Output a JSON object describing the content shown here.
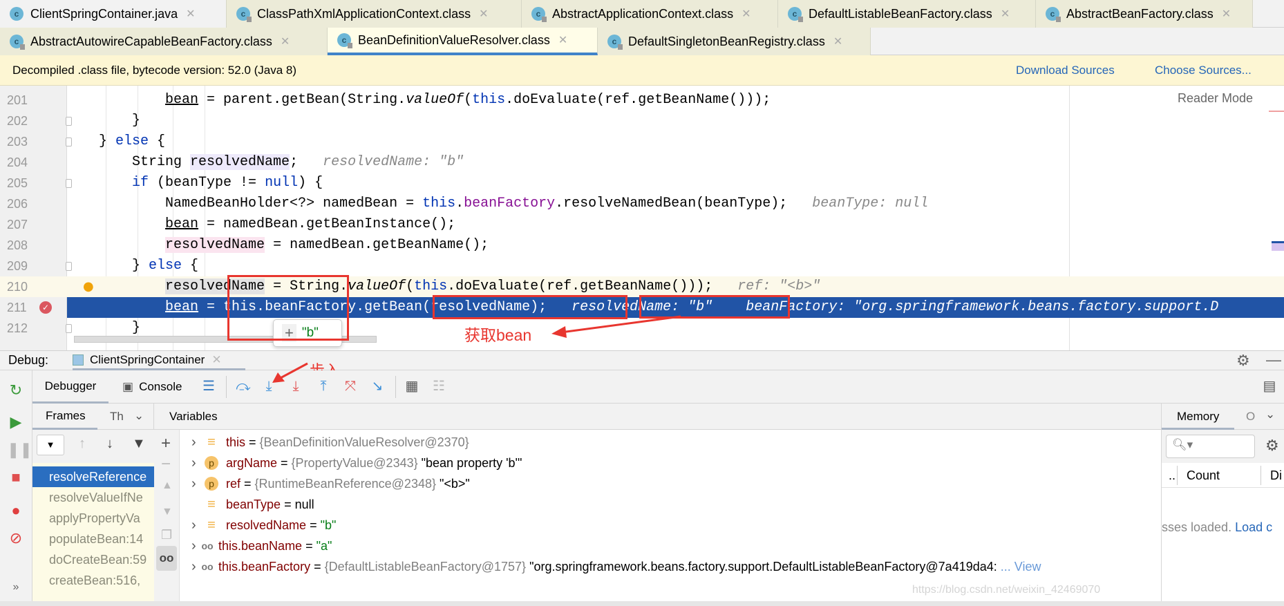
{
  "tabs_row1": [
    {
      "label": "ClientSpringContainer.java",
      "active": false
    },
    {
      "label": "ClassPathXmlApplicationContext.class",
      "active": false
    },
    {
      "label": "AbstractApplicationContext.class",
      "active": false
    },
    {
      "label": "DefaultListableBeanFactory.class",
      "active": false
    },
    {
      "label": "AbstractBeanFactory.class",
      "active": false
    }
  ],
  "tabs_row2": [
    {
      "label": "AbstractAutowireCapableBeanFactory.class",
      "active": false
    },
    {
      "label": "BeanDefinitionValueResolver.class",
      "active": true
    },
    {
      "label": "DefaultSingletonBeanRegistry.class",
      "active": false
    }
  ],
  "banner": {
    "text": "Decompiled .class file, bytecode version: 52.0 (Java 8)",
    "download": "Download Sources",
    "choose": "Choose Sources..."
  },
  "editor": {
    "reader_mode": "Reader Mode",
    "current_line": 211,
    "caret_line": 210,
    "lines": [
      {
        "n": "201",
        "indent": 20,
        "tokens": [
          [
            "bean",
            "ul"
          ],
          [
            " = parent.getBean(String.",
            ""
          ],
          [
            "valueOf",
            "it"
          ],
          [
            "(",
            ""
          ],
          [
            "this",
            "kw"
          ],
          [
            ".doEvaluate(ref.getBeanName()));",
            ""
          ]
        ]
      },
      {
        "n": "202",
        "indent": 16,
        "tokens": [
          [
            "}",
            ""
          ]
        ]
      },
      {
        "n": "203",
        "indent": 12,
        "tokens": [
          [
            "} ",
            ""
          ],
          [
            "else",
            "kw"
          ],
          [
            " {",
            ""
          ]
        ]
      },
      {
        "n": "204",
        "indent": 16,
        "tokens": [
          [
            "String ",
            ""
          ],
          [
            "resolvedName",
            "hl1"
          ],
          [
            ";",
            ""
          ],
          [
            "   resolvedName: \"b\"",
            "hint"
          ]
        ]
      },
      {
        "n": "205",
        "indent": 16,
        "tokens": [
          [
            "if",
            "kw"
          ],
          [
            " (beanType != ",
            ""
          ],
          [
            "null",
            "kw"
          ],
          [
            ") {",
            ""
          ]
        ]
      },
      {
        "n": "206",
        "indent": 20,
        "tokens": [
          [
            "NamedBeanHolder<?> namedBean = ",
            ""
          ],
          [
            "this",
            "kw"
          ],
          [
            ".",
            ""
          ],
          [
            "beanFactory",
            "fld"
          ],
          [
            ".resolveNamedBean(beanType);",
            ""
          ],
          [
            "   beanType: null",
            "hint"
          ]
        ]
      },
      {
        "n": "207",
        "indent": 20,
        "tokens": [
          [
            "bean",
            "ul"
          ],
          [
            " = namedBean.getBeanInstance();",
            ""
          ]
        ]
      },
      {
        "n": "208",
        "indent": 20,
        "tokens": [
          [
            "resolvedName",
            "hl2"
          ],
          [
            " = namedBean.getBeanName();",
            ""
          ]
        ]
      },
      {
        "n": "209",
        "indent": 16,
        "tokens": [
          [
            "} ",
            ""
          ],
          [
            "else",
            "kw"
          ],
          [
            " {",
            ""
          ]
        ]
      },
      {
        "n": "210",
        "indent": 20,
        "tokens": [
          [
            "resolvedName",
            "hl3"
          ],
          [
            " = String.",
            ""
          ],
          [
            "valueOf",
            "it"
          ],
          [
            "(",
            ""
          ],
          [
            "this",
            "kw"
          ],
          [
            ".doEvaluate(ref.getBeanName()));",
            ""
          ],
          [
            "   ref: \"<b>\"",
            "hint"
          ]
        ]
      },
      {
        "n": "211",
        "indent": 20,
        "tokens": [
          [
            "bean",
            "ul"
          ],
          [
            " = this.beanFactory.getBean(resolvedName);",
            ""
          ],
          [
            "   resolvedName: \"b\"",
            "hint"
          ],
          [
            "    beanFactory: \"org.springframework.beans.factory.support.D",
            "hint"
          ]
        ]
      },
      {
        "n": "212",
        "indent": 16,
        "tokens": [
          [
            "}",
            ""
          ]
        ]
      }
    ],
    "popup_value": "\"b\""
  },
  "annotations": {
    "get_bean": "获取bean",
    "step_into": "步入",
    "color": "#e8362f"
  },
  "debug": {
    "label": "Debug:",
    "session": "ClientSpringContainer",
    "tabs": {
      "debugger": "Debugger",
      "console": "Console"
    },
    "frames_tab": "Frames",
    "threads_tab": "Th",
    "variables_tab": "Variables",
    "frames": [
      "resolveReference",
      "resolveValueIfNe",
      "applyPropertyVa",
      "populateBean:14",
      "doCreateBean:59",
      "createBean:516,"
    ],
    "variables": [
      {
        "icon": "field",
        "expandable": true,
        "name": "this",
        "type": "{BeanDefinitionValueResolver@2370}",
        "value": "",
        "vclass": ""
      },
      {
        "icon": "param",
        "expandable": true,
        "name": "argName",
        "type": "{PropertyValue@2343}",
        "value": "\"bean property 'b'\"",
        "vclass": ""
      },
      {
        "icon": "param",
        "expandable": true,
        "name": "ref",
        "type": "{RuntimeBeanReference@2348}",
        "value": "\"<b>\"",
        "vclass": ""
      },
      {
        "icon": "field",
        "expandable": false,
        "name": "beanType",
        "type": "",
        "value": "null",
        "vclass": ""
      },
      {
        "icon": "field",
        "expandable": true,
        "name": "resolvedName",
        "type": "",
        "value": "\"b\"",
        "vclass": "vstr"
      },
      {
        "icon": "watch",
        "expandable": true,
        "name": "this.beanName",
        "type": "",
        "value": "\"a\"",
        "vclass": "vstr"
      },
      {
        "icon": "watch",
        "expandable": true,
        "name": "this.beanFactory",
        "type": "{DefaultListableBeanFactory@1757}",
        "value": "\"org.springframework.beans.factory.support.DefaultListableBeanFactory@7a419da4:",
        "vclass": "",
        "more": "... View"
      }
    ],
    "memory": {
      "tab": "Memory",
      "other_tab": "O",
      "col_name": "..",
      "col_count": "Count",
      "col_diff": "Di",
      "status": "sses loaded.",
      "load_link": "Load c"
    }
  },
  "watermark": "https://blog.csdn.net/weixin_42469070"
}
